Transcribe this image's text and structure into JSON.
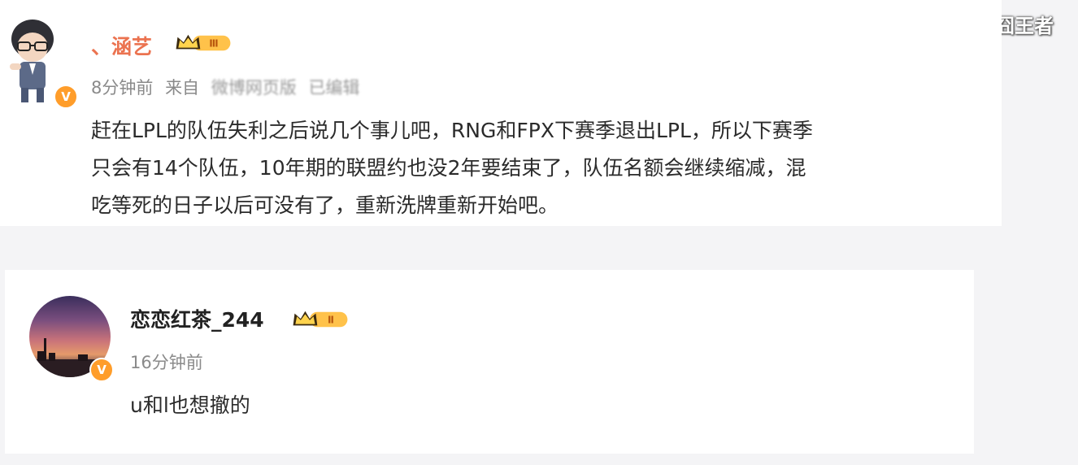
{
  "watermark": "搜狐号@囧王者",
  "comments": [
    {
      "username": "、涵艺",
      "level_badge": "Ⅲ",
      "time": "8分钟前",
      "source": "来自",
      "source_name": "微博网页版",
      "edited": "已编辑",
      "verified_icon": "v-badge-icon",
      "lines": [
        "赶在LPL的队伍失利之后说几个事儿吧，RNG和FPX下赛季退出LPL，所以下赛季",
        "只会有14个队伍，10年期的联盟约也没2年要结束了，队伍名额会继续缩减，混",
        "吃等死的日子以后可没有了，重新洗牌重新开始吧。"
      ]
    },
    {
      "username": "恋恋红茶_244",
      "level_badge": "Ⅱ",
      "time": "16分钟前",
      "verified_icon": "v-badge-icon",
      "text": "u和l也想撤的"
    }
  ],
  "colors": {
    "username_highlight": "#eb7350",
    "badge_orange": "#ff9d2a",
    "meta_gray": "#8a8a8a"
  }
}
